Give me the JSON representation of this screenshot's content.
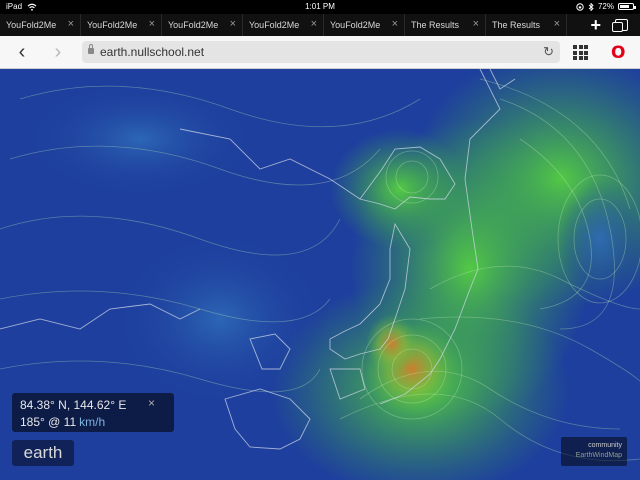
{
  "status_bar": {
    "device": "iPad",
    "time": "1:01 PM",
    "battery": "72%",
    "battery_level": 0.72
  },
  "tabs": [
    {
      "label": "YouFold2Me"
    },
    {
      "label": "YouFold2Me"
    },
    {
      "label": "YouFold2Me"
    },
    {
      "label": "YouFold2Me"
    },
    {
      "label": "YouFold2Me"
    },
    {
      "label": "The Results"
    },
    {
      "label": "The Results"
    }
  ],
  "toolbar": {
    "url": "earth.nullschool.net"
  },
  "icons": {
    "wifi": "wifi-icon",
    "lock": "lock-icon",
    "reload": "reload-icon",
    "apps": "grid-icon",
    "browser": "opera-icon"
  },
  "map": {
    "coordinates": "84.38° N, 144.62° E",
    "wind": "185° @ 11",
    "wind_unit": "km/h",
    "earth_label": "earth",
    "badge_line1": "community",
    "badge_line2": "EarthWindMap"
  },
  "colors": {
    "ocean_low": "#1c3c9a",
    "wind_mid": "#3fbf3f",
    "wind_high": "#d9792a",
    "accent": "#e2001a"
  }
}
